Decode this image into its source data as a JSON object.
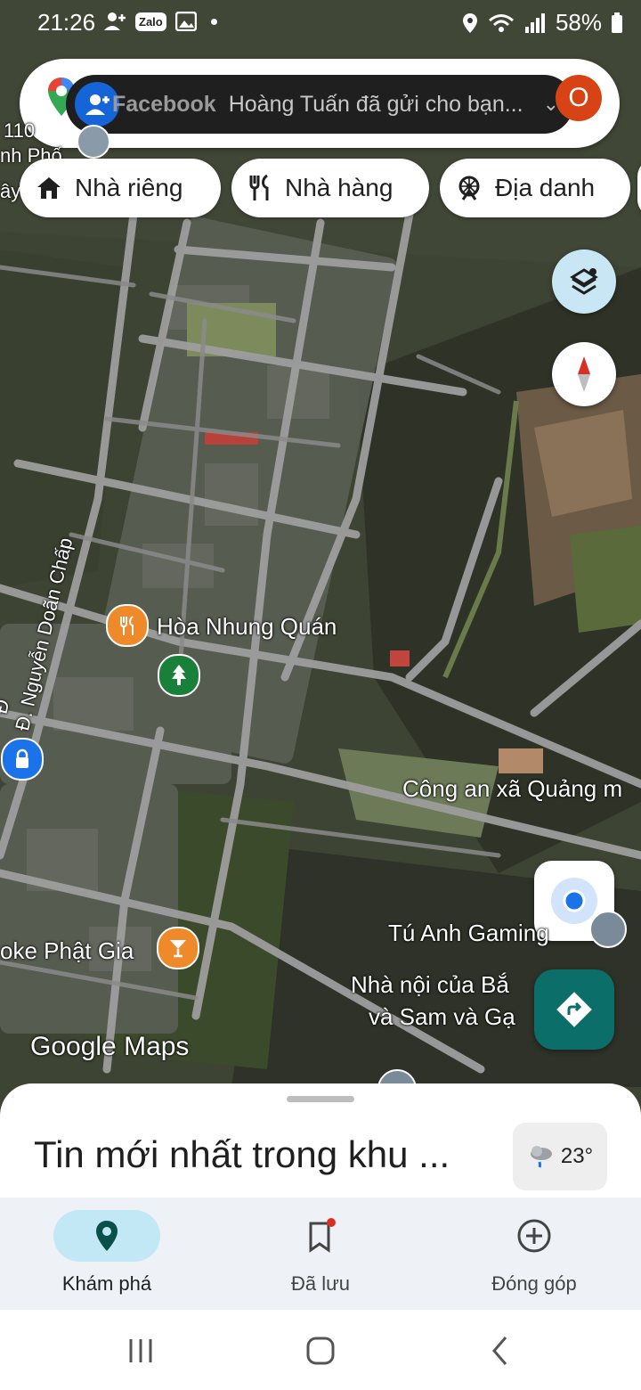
{
  "status_bar": {
    "time": "21:26",
    "zalo_label": "Zalo",
    "battery": "58%"
  },
  "notification": {
    "app": "Facebook",
    "message": "Hoàng Tuấn đã gửi cho bạn..."
  },
  "profile_initial": "O",
  "chips": [
    {
      "label": "Nhà riêng",
      "icon": "home-icon"
    },
    {
      "label": "Nhà hàng",
      "icon": "restaurant-icon"
    },
    {
      "label": "Địa danh",
      "icon": "landmark-icon"
    }
  ],
  "map": {
    "edge_labels": [
      "110",
      "nh Phố",
      "ây"
    ],
    "street_label": "Đ. Nguyễn Doãn Chấp",
    "places": [
      "Hòa Nhung Quán",
      "Công an xã Quảng m",
      "Tú Anh Gaming",
      "Nhà nội của Bắ",
      "và Sam và Gạ",
      "oke Phật Gia"
    ],
    "watermark": "Google Maps"
  },
  "sheet": {
    "title": "Tin mới nhất trong khu ...",
    "weather_temp": "23°"
  },
  "nav": [
    {
      "label": "Khám phá",
      "icon": "explore-pin-icon",
      "active": true
    },
    {
      "label": "Đã lưu",
      "icon": "bookmark-icon",
      "active": false
    },
    {
      "label": "Đóng góp",
      "icon": "add-circle-icon",
      "active": false
    }
  ],
  "colors": {
    "accent": "#0b6e69",
    "active_pill": "#c2e7f5",
    "dot": "#d93025",
    "location": "#1a73e8"
  }
}
